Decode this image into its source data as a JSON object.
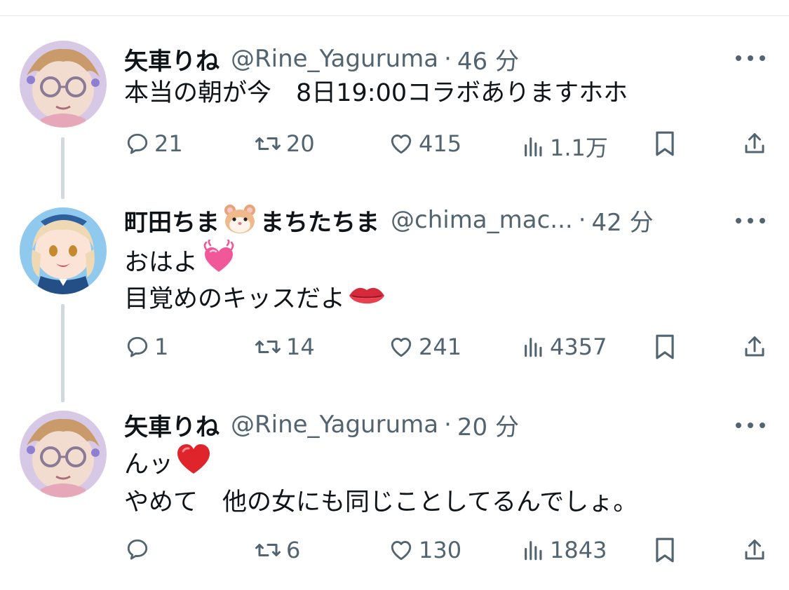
{
  "tweets": [
    {
      "name": "矢車りね",
      "handle": "@Rine_Yaguruma",
      "dot": "·",
      "time": "46 分",
      "lines": [
        "本当の朝が今　8日19:00コラボありますホホ"
      ],
      "replies": "21",
      "retweets": "20",
      "likes": "415",
      "views": "1.1万"
    },
    {
      "name": "町田ちま",
      "name_suffix": "まちたちま",
      "name_emoji": "hamster-face",
      "handle": "@chima_mac...",
      "dot": "·",
      "time": "42 分",
      "lines": [
        "おはよ",
        "目覚めのキッスだよ"
      ],
      "line_emojis": [
        "heart-pulse-pink",
        "lips"
      ],
      "replies": "1",
      "retweets": "14",
      "likes": "241",
      "views": "4357"
    },
    {
      "name": "矢車りね",
      "handle": "@Rine_Yaguruma",
      "dot": "·",
      "time": "20 分",
      "lines": [
        "んッ",
        "やめて　他の女にも同じことしてるんでしょ。"
      ],
      "line_emojis": [
        "red-heart"
      ],
      "replies": "",
      "retweets": "6",
      "likes": "130",
      "views": "1843"
    }
  ],
  "colors": {
    "text": "#0f1419",
    "muted": "#536471",
    "thread": "#cfd9de",
    "heart_red": "#e0242b",
    "heart_pink": "#f0589a"
  }
}
